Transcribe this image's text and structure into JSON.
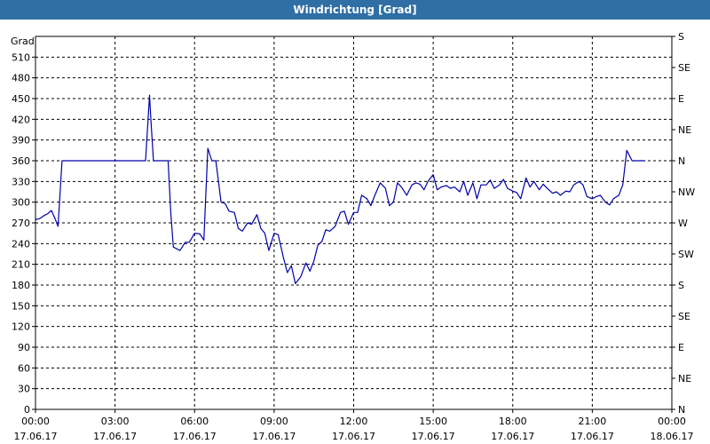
{
  "window": {
    "title": "Windrichtung [Grad]"
  },
  "chart_data": {
    "type": "line",
    "title": "Windrichtung [Grad]",
    "ylabel": "Grad",
    "xlabel": "",
    "ylim": [
      0,
      540
    ],
    "xlim_hours": [
      0,
      24
    ],
    "grid": true,
    "line_color": "#0000aa",
    "y_ticks": [
      0,
      30,
      60,
      90,
      120,
      150,
      180,
      210,
      240,
      270,
      300,
      330,
      360,
      390,
      420,
      450,
      480,
      510
    ],
    "y_tick_labels": [
      "0",
      "30",
      "60",
      "90",
      "120",
      "150",
      "180",
      "210",
      "240",
      "270",
      "300",
      "330",
      "360",
      "390",
      "420",
      "450",
      "480",
      "510"
    ],
    "y2_ticks": [
      0,
      45,
      90,
      135,
      180,
      225,
      270,
      315,
      360,
      405,
      450,
      495,
      540
    ],
    "y2_tick_labels": [
      "N",
      "NE",
      "E",
      "SE",
      "S",
      "SW",
      "W",
      "NW",
      "N",
      "NE",
      "E",
      "SE",
      "S"
    ],
    "x_ticks_hours": [
      0,
      3,
      6,
      9,
      12,
      15,
      18,
      21,
      24
    ],
    "x_tick_labels": [
      [
        "00:00",
        "17.06.17"
      ],
      [
        "03:00",
        "17.06.17"
      ],
      [
        "06:00",
        "17.06.17"
      ],
      [
        "09:00",
        "17.06.17"
      ],
      [
        "12:00",
        "17.06.17"
      ],
      [
        "15:00",
        "17.06.17"
      ],
      [
        "18:00",
        "17.06.17"
      ],
      [
        "21:00",
        "17.06.17"
      ],
      [
        "00:00",
        "18.06.17"
      ]
    ],
    "series": [
      {
        "x_hours": [
          0,
          0.15,
          0.3,
          0.45,
          0.6,
          0.75,
          0.85,
          1.0,
          1.2,
          2.0,
          3.0,
          4.0,
          4.15,
          4.3,
          4.35,
          4.45,
          4.6,
          5.0,
          5.1,
          5.2,
          5.45,
          5.65,
          5.8,
          6.0,
          6.2,
          6.35,
          6.5,
          6.65,
          6.8,
          7.0,
          7.15,
          7.3,
          7.5,
          7.65,
          7.8,
          8.0,
          8.15,
          8.35,
          8.5,
          8.65,
          8.8,
          9.0,
          9.15,
          9.35,
          9.5,
          9.65,
          9.8,
          10.0,
          10.2,
          10.35,
          10.5,
          10.65,
          10.8,
          10.95,
          11.1,
          11.3,
          11.5,
          11.65,
          11.8,
          12.0,
          12.15,
          12.3,
          12.5,
          12.65,
          12.8,
          13.0,
          13.2,
          13.35,
          13.5,
          13.65,
          13.8,
          14.0,
          14.2,
          14.35,
          14.5,
          14.65,
          14.8,
          15.0,
          15.15,
          15.3,
          15.5,
          15.65,
          15.8,
          16.0,
          16.15,
          16.3,
          16.5,
          16.65,
          16.8,
          17.0,
          17.15,
          17.3,
          17.5,
          17.65,
          17.8,
          18.0,
          18.15,
          18.3,
          18.5,
          18.65,
          18.8,
          19.0,
          19.15,
          19.3,
          19.5,
          19.65,
          19.8,
          20.0,
          20.15,
          20.3,
          20.5,
          20.65,
          20.8,
          21.0,
          21.15,
          21.3,
          21.5,
          21.65,
          21.8,
          22.0,
          22.15,
          22.3,
          22.5,
          22.65,
          22.8,
          23.0,
          23.5,
          24.0
        ],
        "values": [
          275,
          276,
          280,
          283,
          288,
          275,
          265,
          360,
          360,
          360,
          360,
          360,
          360,
          455,
          420,
          360,
          360,
          360,
          285,
          235,
          230,
          242,
          242,
          255,
          254,
          245,
          378,
          360,
          360,
          300,
          298,
          287,
          285,
          262,
          258,
          270,
          268,
          282,
          262,
          255,
          230,
          255,
          253,
          220,
          198,
          208,
          182,
          192,
          212,
          200,
          215,
          238,
          243,
          260,
          258,
          265,
          285,
          287,
          268,
          285,
          285,
          310,
          305,
          295,
          310,
          328,
          320,
          295,
          300,
          328,
          322,
          310,
          325,
          328,
          326,
          318,
          330,
          340,
          318,
          322,
          324,
          320,
          322,
          315,
          330,
          310,
          328,
          305,
          325,
          325,
          332,
          320,
          325,
          333,
          320,
          316,
          314,
          305,
          335,
          322,
          330,
          318,
          326,
          320,
          313,
          315,
          310,
          316,
          315,
          325,
          330,
          325,
          308,
          305,
          308,
          310,
          300,
          296,
          305,
          310,
          325,
          375,
          360,
          360,
          360,
          360
        ]
      }
    ]
  }
}
